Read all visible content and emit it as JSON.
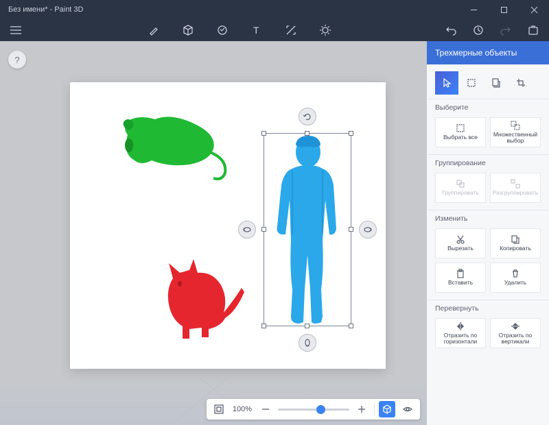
{
  "title": "Без имени* - Paint 3D",
  "panel": {
    "header": "Трехмерные объекты",
    "sections": {
      "select": {
        "title": "Выберите",
        "select_all": "Выбрать все",
        "multi": "Множественный выбор"
      },
      "group": {
        "title": "Группирование",
        "group": "Группировать",
        "ungroup": "Разгруппировать"
      },
      "edit": {
        "title": "Изменить",
        "cut": "Вырезать",
        "copy": "Копировать",
        "paste": "Вставить",
        "delete": "Удалить"
      },
      "flip": {
        "title": "Перевернуть",
        "flip_h": "Отразить по горизонтали",
        "flip_v": "Отразить по вертикали"
      }
    }
  },
  "zoom": {
    "value": "100%"
  },
  "canvas_objects": [
    "green-mouse-3d",
    "red-cat-3d",
    "blue-man-3d-selected"
  ]
}
